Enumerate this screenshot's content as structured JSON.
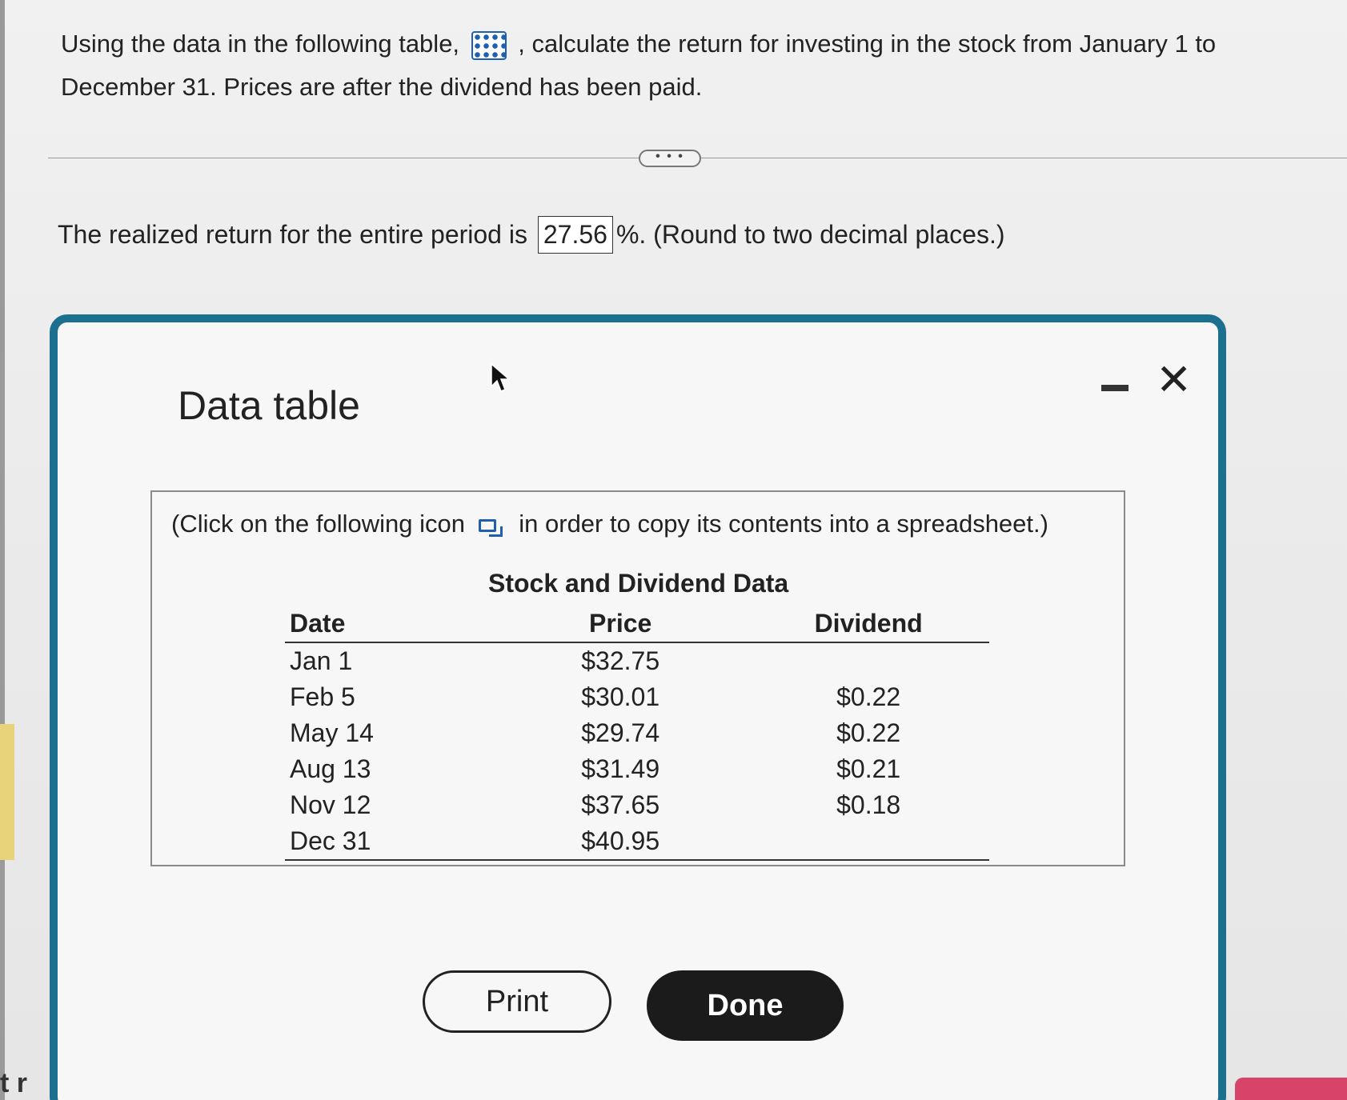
{
  "question": {
    "text_before_icon": "Using the data in the following table,",
    "text_after_icon": ", calculate the return for investing in the stock from January 1 to December 31. Prices are after the dividend has been paid."
  },
  "more_label": "• • •",
  "answer": {
    "prefix": "The realized return for the entire period is",
    "value": "27.56",
    "suffix": "%. (Round to two decimal places.)"
  },
  "dialog": {
    "title": "Data table",
    "minimize_icon": "minimize-icon",
    "close_label": "✕",
    "copy_note_before": "(Click on the following icon",
    "copy_note_after": "in order to copy its contents into a spreadsheet.)",
    "table": {
      "caption": "Stock and Dividend Data",
      "headers": [
        "Date",
        "Price",
        "Dividend"
      ],
      "rows": [
        [
          "Jan 1",
          "$32.75",
          ""
        ],
        [
          "Feb 5",
          "$30.01",
          "$0.22"
        ],
        [
          "May 14",
          "$29.74",
          "$0.22"
        ],
        [
          "Aug 13",
          "$31.49",
          "$0.21"
        ],
        [
          "Nov 12",
          "$37.65",
          "$0.18"
        ],
        [
          "Dec 31",
          "$40.95",
          ""
        ]
      ]
    },
    "print_label": "Print",
    "done_label": "Done"
  },
  "edge_text": "t r"
}
